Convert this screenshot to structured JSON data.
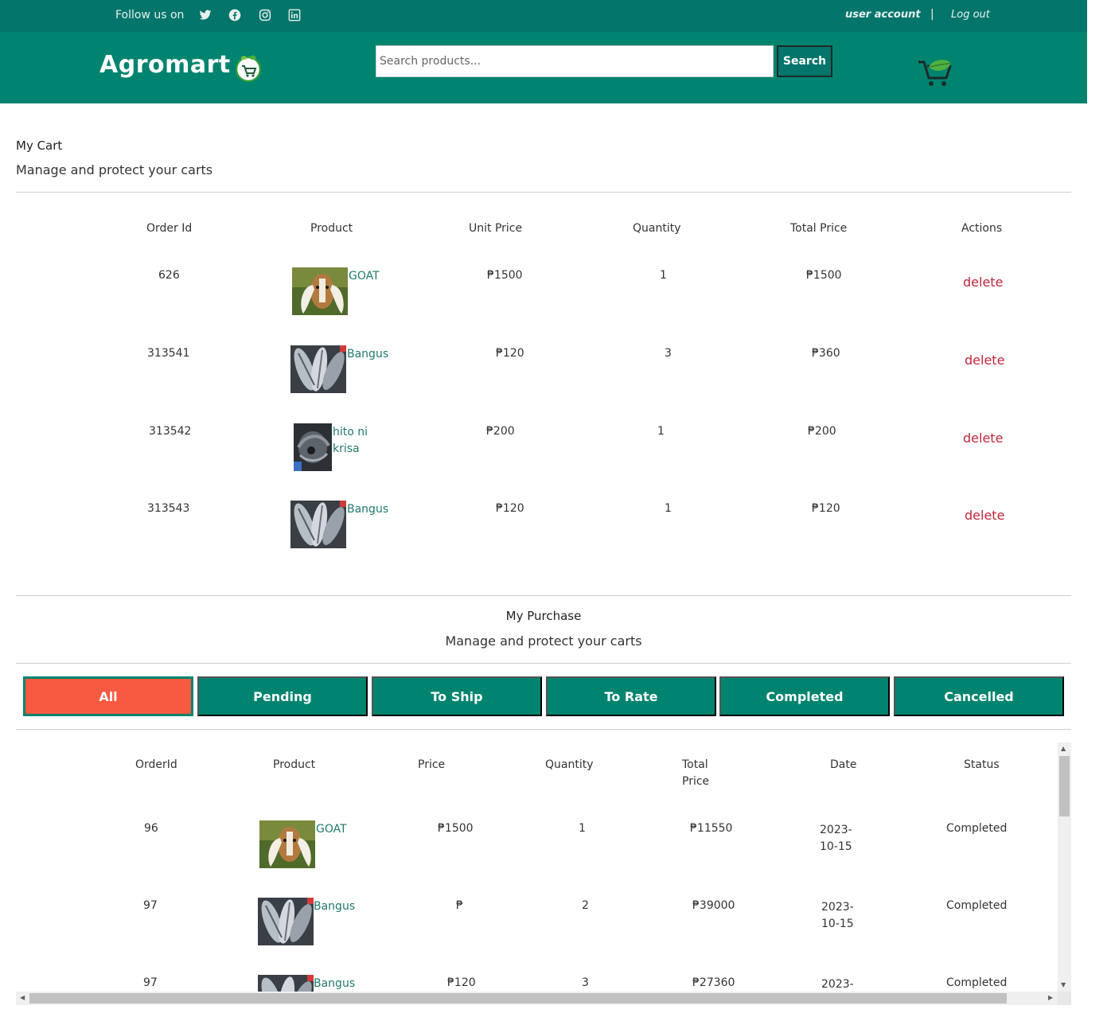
{
  "topbar": {
    "follow_label": "Follow us on",
    "socials": [
      "twitter-icon",
      "facebook-icon",
      "instagram-icon",
      "linkedin-icon"
    ],
    "user_account": "user account",
    "separator": "|",
    "logout": "Log out"
  },
  "header": {
    "brand": "Agromart",
    "search_placeholder": "Search products...",
    "search_button": "Search"
  },
  "cart": {
    "title": "My Cart",
    "subtitle": "Manage and protect your carts",
    "columns": [
      "Order Id",
      "Product",
      "Unit Price",
      "Quantity",
      "Total Price",
      "Actions"
    ],
    "rows": [
      {
        "order_id": "626",
        "product": "GOAT",
        "unit_price": "₱1500",
        "quantity": "1",
        "total": "₱1500",
        "action": "delete"
      },
      {
        "order_id": "313541",
        "product": "Bangus",
        "unit_price": "₱120",
        "quantity": "3",
        "total": "₱360",
        "action": "delete"
      },
      {
        "order_id": "313542",
        "product": "hito ni krisa",
        "product_line1": "hito ni",
        "product_line2": "krisa",
        "unit_price": "₱200",
        "quantity": "1",
        "total": "₱200",
        "action": "delete"
      },
      {
        "order_id": "313543",
        "product": "Bangus",
        "unit_price": "₱120",
        "quantity": "1",
        "total": "₱120",
        "action": "delete"
      }
    ]
  },
  "purchase": {
    "title": "My Purchase",
    "subtitle": "Manage and protect your carts",
    "tabs": [
      "All",
      "Pending",
      "To Ship",
      "To Rate",
      "Completed",
      "Cancelled"
    ],
    "active_tab": "All",
    "columns": [
      "OrderId",
      "Product",
      "Price",
      "Quantity",
      "Total",
      "Price",
      "Date",
      "Status"
    ],
    "rows": [
      {
        "order_id": "96",
        "product": "GOAT",
        "price": "₱1500",
        "quantity": "1",
        "total": "₱11550",
        "date_line1": "2023-",
        "date_line2": "10-15",
        "status": "Completed"
      },
      {
        "order_id": "97",
        "product": "Bangus",
        "price": "₱",
        "quantity": "2",
        "total": "₱39000",
        "date_line1": "2023-",
        "date_line2": "10-15",
        "status": "Completed"
      },
      {
        "order_id": "97",
        "product": "Bangus",
        "price": "₱120",
        "quantity": "3",
        "total": "₱27360",
        "date_line1": "2023-",
        "date_line2": "",
        "status": "Completed"
      }
    ]
  },
  "colors": {
    "topbar": "#04756b",
    "header": "#00846f",
    "active_tab": "#f75a40",
    "delete": "#c0263a",
    "link": "#1f7a6b"
  }
}
